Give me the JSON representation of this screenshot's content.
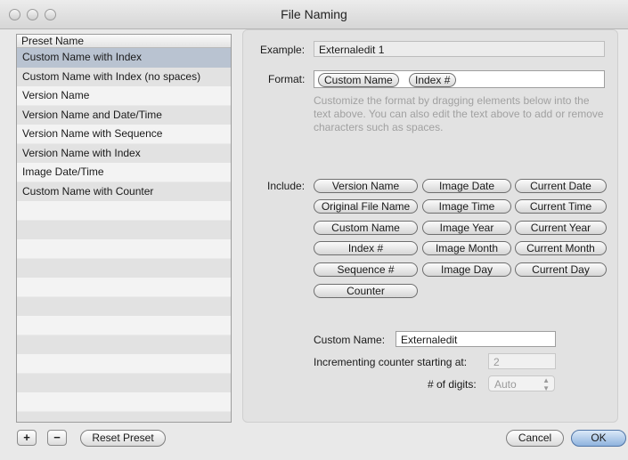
{
  "window": {
    "title": "File Naming"
  },
  "preset_list": {
    "header": "Preset Name",
    "items": [
      "Custom Name with Index",
      "Custom Name with Index (no spaces)",
      "Version Name",
      "Version Name and Date/Time",
      "Version Name with Sequence",
      "Version Name with Index",
      "Image Date/Time",
      "Custom Name with Counter"
    ],
    "selected": "Custom Name with Index"
  },
  "bottom_left": {
    "add": "+",
    "remove": "−",
    "reset": "Reset Preset"
  },
  "example": {
    "label": "Example:",
    "value": "Externaledit 1"
  },
  "format": {
    "label": "Format:",
    "tokens": [
      "Custom Name",
      "Index #"
    ]
  },
  "help_text": "Customize the format by dragging elements below into the text above. You can also edit the text above to add or remove characters such as spaces.",
  "include": {
    "label": "Include:",
    "tokens": [
      [
        "Version Name",
        "Image Date",
        "Current Date"
      ],
      [
        "Original File Name",
        "Image Time",
        "Current Time"
      ],
      [
        "Custom Name",
        "Image Year",
        "Current Year"
      ],
      [
        "Index #",
        "Image Month",
        "Current Month"
      ],
      [
        "Sequence #",
        "Image Day",
        "Current Day"
      ],
      [
        "Counter"
      ]
    ]
  },
  "custom_name": {
    "label": "Custom Name:",
    "value": "Externaledit"
  },
  "counter": {
    "label": "Incrementing counter starting at:",
    "value": "2"
  },
  "digits": {
    "label": "# of digits:",
    "value": "Auto"
  },
  "buttons": {
    "cancel": "Cancel",
    "ok": "OK"
  }
}
